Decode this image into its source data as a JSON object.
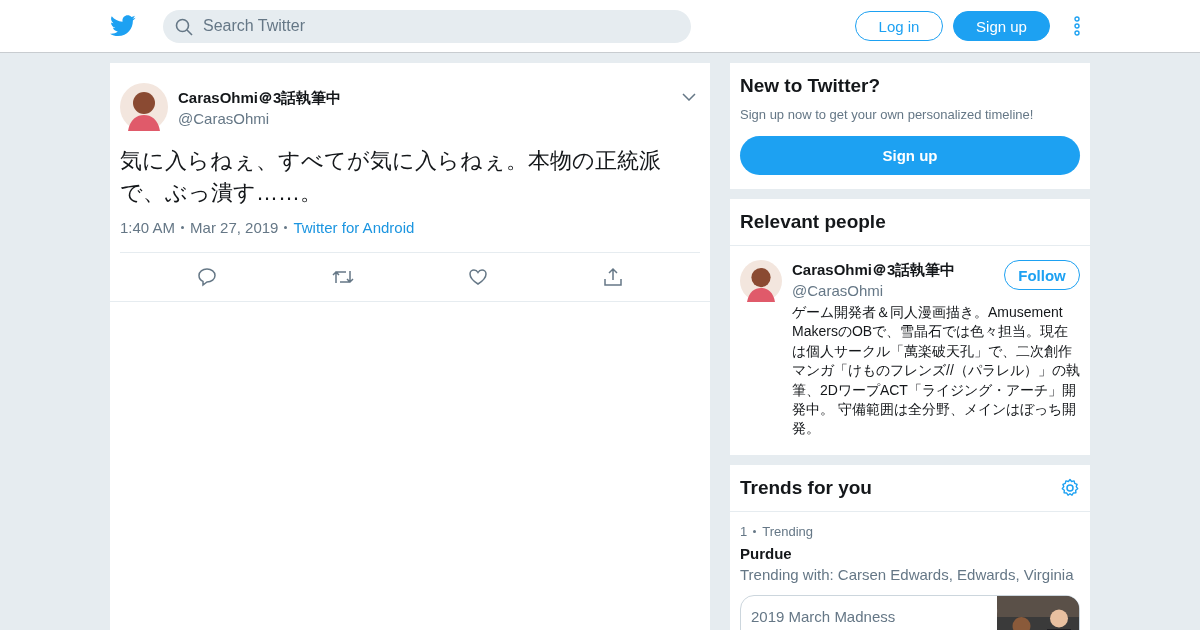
{
  "header": {
    "search": {
      "placeholder": "Search Twitter"
    },
    "login": "Log in",
    "signup": "Sign up"
  },
  "tweet": {
    "name": "CarasOhmi＠3話執筆中",
    "handle": "@CarasOhmi",
    "text": "気に入らねぇ、すべてが気に入らねぇ。本物の正統派で、ぶっ潰す……。",
    "time": "1:40 AM",
    "date": "Mar 27, 2019",
    "source": "Twitter for Android"
  },
  "signup_card": {
    "title": "New to Twitter?",
    "subtitle": "Sign up now to get your own personalized timeline!",
    "button": "Sign up"
  },
  "relevant_people": {
    "title": "Relevant people",
    "people": [
      {
        "name": "CarasOhmi＠3話執筆中",
        "handle": "@CarasOhmi",
        "follow": "Follow",
        "bio": "ゲーム開発者＆同人漫画描き。Amusement MakersのOBで、雪晶石では色々担当。現在は個人サークル「萬楽破天孔」で、二次創作マンガ「けものフレンズ//（パラレル）」の執筆、2DワープACT「ライジング・アーチ」開発中。 守備範囲は全分野、メインはぼっち開発。"
      }
    ]
  },
  "trends": {
    "title": "Trends for you",
    "items": [
      {
        "rank": "1",
        "label": "Trending",
        "name": "Purdue",
        "related": "Trending with: Carsen Edwards, Edwards, Virginia",
        "story": {
          "category": "2019 March Madness",
          "kind": "picture"
        }
      }
    ]
  }
}
